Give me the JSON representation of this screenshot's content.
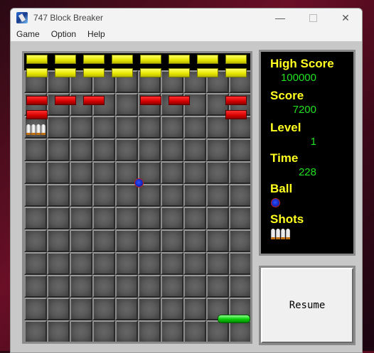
{
  "window": {
    "title": "747 Block Breaker",
    "minimize_icon": "minimize-icon",
    "maximize_icon": "maximize-icon",
    "close_icon": "close-icon"
  },
  "menu": [
    "Game",
    "Option",
    "Help"
  ],
  "playfield": {
    "bricks": {
      "yellow_row_1": 8,
      "yellow_row_2": 8,
      "red_row_1": [
        "red",
        "red",
        "red",
        "",
        "red",
        "red",
        "",
        "red"
      ],
      "red_row_2": [
        "red",
        "",
        "",
        "",
        "",
        "",
        "",
        "red"
      ]
    },
    "shots_on_field": 4
  },
  "status": {
    "high_score_label": "High Score",
    "high_score": "100000",
    "score_label": "Score",
    "score": "7200",
    "level_label": "Level",
    "level": "1",
    "time_label": "Time",
    "time": "228",
    "ball_label": "Ball",
    "balls_remaining": 1,
    "shots_label": "Shots",
    "shots_remaining": 4
  },
  "resume_label": "Resume",
  "colors": {
    "label": "#ffff20",
    "value": "#20e020",
    "yellow_brick": "#e6e600",
    "red_brick": "#d40000",
    "paddle": "#10d010",
    "ball": "#1028c0"
  }
}
